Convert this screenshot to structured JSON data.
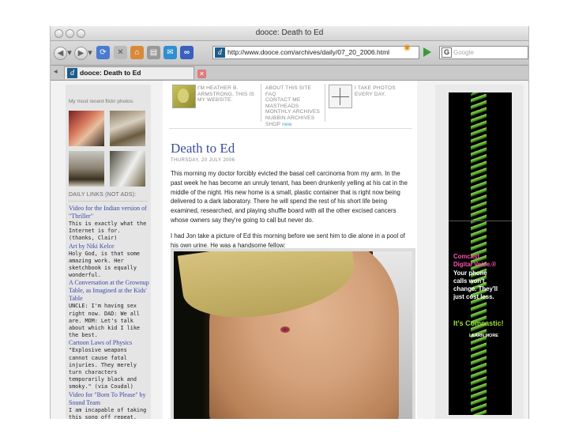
{
  "window": {
    "title": "dooce: Death to Ed"
  },
  "toolbar": {
    "back_icon": "back-arrow-icon",
    "forward_icon": "forward-arrow-icon",
    "url": "http://www.dooce.com/archives/daily/07_20_2006.html",
    "search_placeholder": "Google",
    "search_engine": "G"
  },
  "tab": {
    "label": "dooce: Death to Ed",
    "favicon": "d"
  },
  "sidebar": {
    "flickr_title": "My most recent flickr photos:",
    "links_heading": "DAILY LINKS (NOT ADS):",
    "links": [
      {
        "title": "Video for the Indian version of \"Thriller\"",
        "desc": "This is exactly what the Internet is for. (thanks, Clair)"
      },
      {
        "title": "Art by Niki Kelce",
        "desc": "Holy God, is that some amazing work. Her sketchbook is equally wonderful."
      },
      {
        "title": "A Conversation at the Grownup Table, as Imagined at the Kids' Table",
        "desc": "UNCLE: I'm having sex right now. DAD: We all are. MOM: Let's talk about which kid I like the best."
      },
      {
        "title": "Cartoon Laws of Physics",
        "desc": "\"Explosive weapons cannot cause fatal injuries. They merely turn characters temporarily black and smoky.\" (via Coudal)"
      },
      {
        "title": "Video for \"Born To Please\" by Sound Team",
        "desc": "I am incapable of taking this song off repeat."
      }
    ]
  },
  "header": {
    "bio": "I'M HEATHER B. ARMSTRONG. THIS IS MY WEBSITE.",
    "nav": [
      "ABOUT THIS SITE",
      "FAQ",
      "CONTACT ME",
      "MASTHEADS",
      "MONTHLY ARCHIVES",
      "NUBBIN ARCHIVES",
      "SHOP"
    ],
    "shop_badge": "new",
    "photos": "I TAKE PHOTOS EVERY DAY."
  },
  "post": {
    "title": "Death to Ed",
    "date": "THURSDAY, 20 JULY 2006",
    "p1": "This morning my doctor forcibly evicted the basal cell carcinoma from my arm. In the past week he has become an unruly tenant, has been drunkenly yelling at his cat in the middle of the night. His new home is a small, plastic container that is right now being delivered to a dark laboratory. There he will spend the rest of his short life being examined, researched, and playing shuffle board with all the other excised cancers whose owners say they're going to call but never do.",
    "p2": "I had Jon take a picture of Ed this morning before we sent him to die alone in a pool of his own urine. He was a handsome fellow:"
  },
  "ad": {
    "line1": "Comcast",
    "line2": "Digital Voice.®",
    "line3": "Your phone calls won't change. They'll just cost less.",
    "slogan": "It's Comcastic!",
    "cta": "LEARN MORE"
  }
}
